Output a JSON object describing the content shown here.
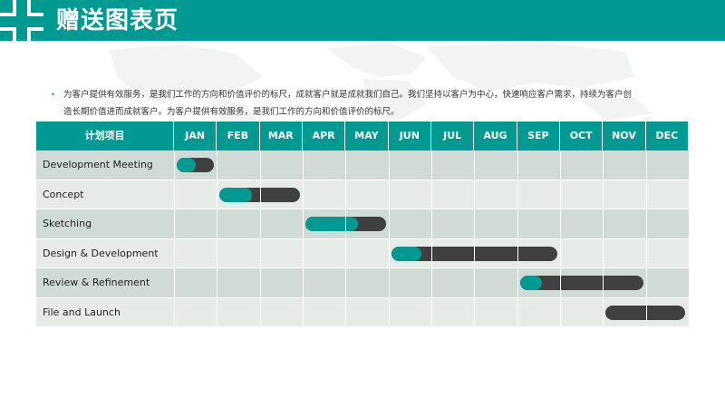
{
  "header": {
    "title": "赠送图表页"
  },
  "intro": {
    "line1": "为客户提供有效服务，是我们工作的方向和价值评价的标尺，成就客户就是成就我们自己。我们坚持以客户为中心，快速响应客户需求，持续为客户创",
    "line2": "造长期价值进而成就客户。为客户提供有效服务，是我们工作的方向和价值评价的标尺。"
  },
  "colors": {
    "accent": "#009a93",
    "bar_remaining": "#404040",
    "row_dark": "#d1dbd5",
    "row_light": "#e6ebe7"
  },
  "chart_data": {
    "type": "table",
    "column_header": "计划项目",
    "months": [
      "JAN",
      "FEB",
      "MAR",
      "APR",
      "MAY",
      "JUN",
      "JUL",
      "AUG",
      "SEP",
      "OCT",
      "NOV",
      "DEC"
    ],
    "tasks": [
      {
        "name": "Development Meeting",
        "start": 1.0,
        "end": 2.0,
        "progress": 0.5
      },
      {
        "name": "Concept",
        "start": 2.0,
        "end": 4.0,
        "progress": 0.4
      },
      {
        "name": "Sketching",
        "start": 4.0,
        "end": 6.0,
        "progress": 0.65
      },
      {
        "name": "Design & Development",
        "start": 6.0,
        "end": 10.0,
        "progress": 0.18
      },
      {
        "name": "Review & Refinement",
        "start": 9.0,
        "end": 12.0,
        "progress": 0.18
      },
      {
        "name": "File and Launch",
        "start": 11.0,
        "end": 13.0,
        "progress": 0.0
      }
    ]
  }
}
